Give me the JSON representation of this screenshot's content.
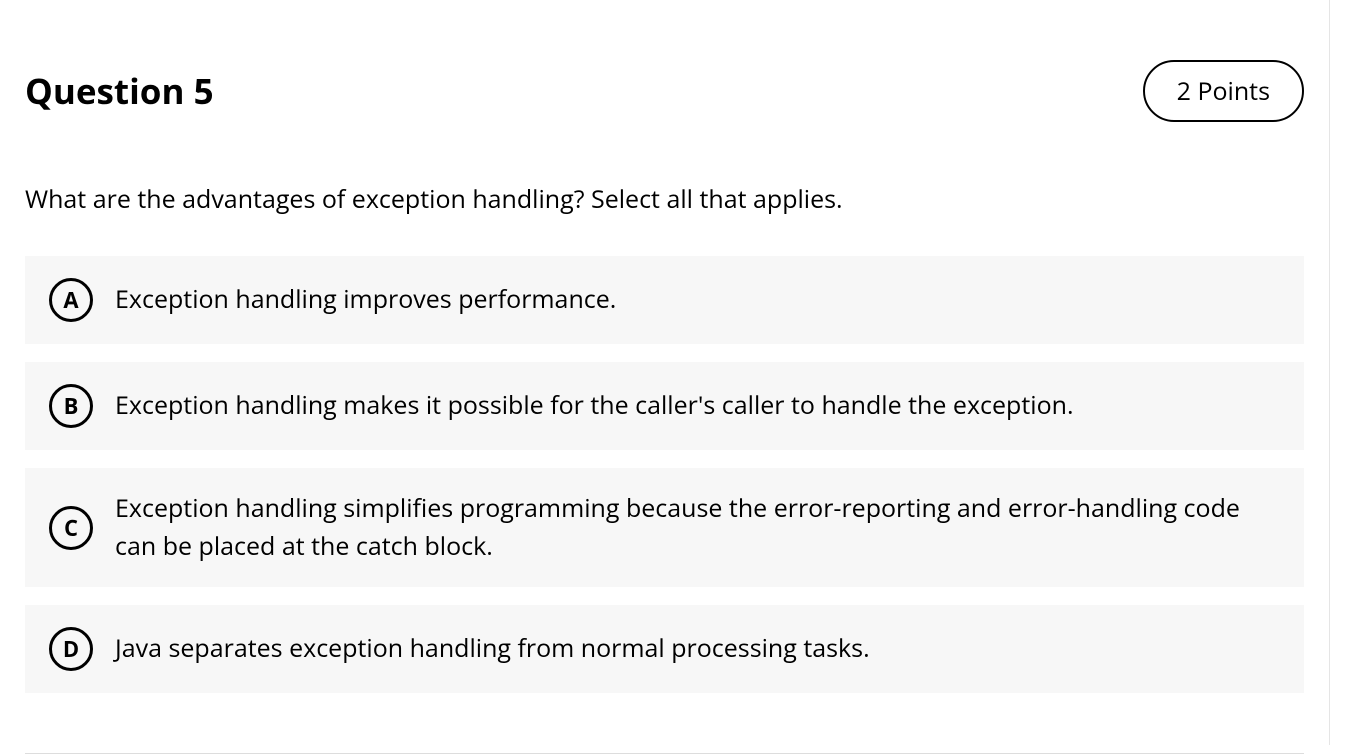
{
  "question": {
    "title": "Question 5",
    "points": "2 Points",
    "text": "What are the advantages of exception handling? Select all that applies.",
    "options": [
      {
        "letter": "A",
        "text": "Exception handling improves performance."
      },
      {
        "letter": "B",
        "text": "Exception handling makes it possible for the caller's caller to handle the exception."
      },
      {
        "letter": "C",
        "text": "Exception handling simplifies programming because the error-reporting and error-handling code can be placed at the catch block."
      },
      {
        "letter": "D",
        "text": "Java separates exception handling from normal processing tasks."
      }
    ]
  }
}
